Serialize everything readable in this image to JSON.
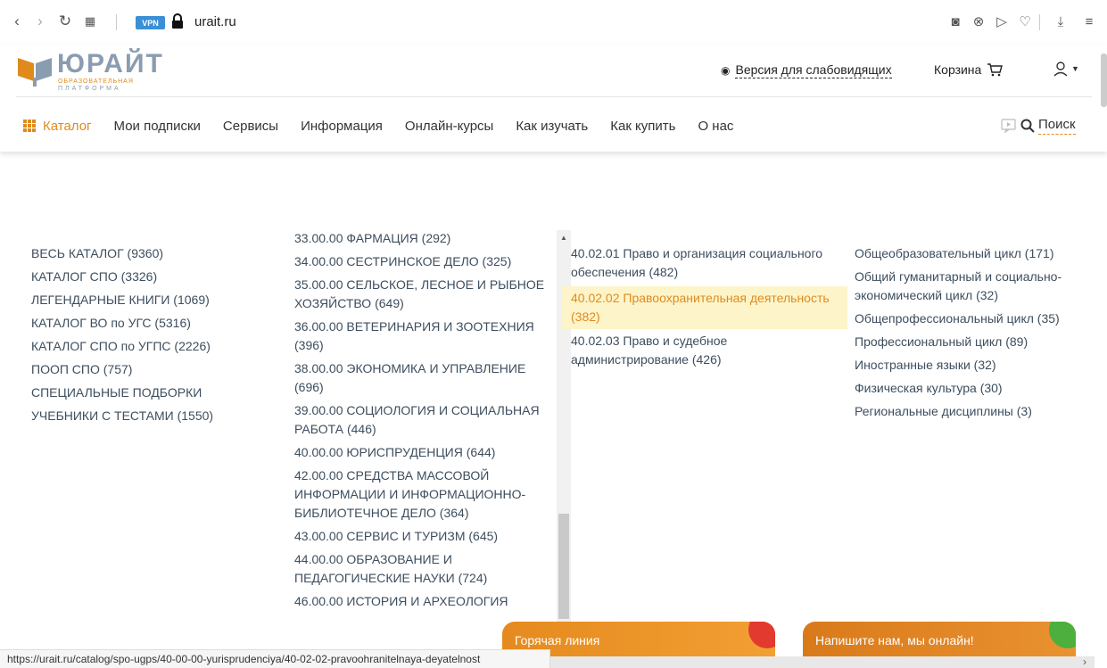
{
  "browser": {
    "url": "urait.ru",
    "vpn_label": "VPN"
  },
  "header": {
    "logo_main": "ЮРАЙТ",
    "logo_sub1": "ОБРАЗОВАТЕЛЬНАЯ",
    "logo_sub2": "ПЛАТФОРМА",
    "vision_label": "Версия для слабовидящих",
    "cart_label": "Корзина"
  },
  "nav": {
    "catalog": "Каталог",
    "items": [
      "Мои подписки",
      "Сервисы",
      "Информация",
      "Онлайн-курсы",
      "Как изучать",
      "Как купить",
      "О нас"
    ],
    "search_label": "Поиск"
  },
  "catalog": {
    "col1": [
      "ВЕСЬ КАТАЛОГ (9360)",
      "КАТАЛОГ СПО (3326)",
      "ЛЕГЕНДАРНЫЕ КНИГИ (1069)",
      "КАТАЛОГ ВО по УГС (5316)",
      "КАТАЛОГ СПО по УГПС (2226)",
      "ПООП СПО (757)",
      "СПЕЦИАЛЬНЫЕ ПОДБОРКИ",
      "УЧЕБНИКИ С ТЕСТАМИ (1550)"
    ],
    "col2": [
      "33.00.00 ФАРМАЦИЯ (292)",
      "34.00.00 СЕСТРИНСКОЕ ДЕЛО (325)",
      "35.00.00 СЕЛЬСКОЕ, ЛЕСНОЕ И РЫБНОЕ ХОЗЯЙСТВО (649)",
      "36.00.00 ВЕТЕРИНАРИЯ И ЗООТЕХНИЯ (396)",
      "38.00.00 ЭКОНОМИКА И УПРАВЛЕНИЕ (696)",
      "39.00.00 СОЦИОЛОГИЯ И СОЦИАЛЬНАЯ РАБОТА (446)",
      "40.00.00 ЮРИСПРУДЕНЦИЯ (644)",
      "42.00.00 СРЕДСТВА МАССОВОЙ ИНФОРМАЦИИ И ИНФОРМАЦИОННО-БИБЛИОТЕЧНОЕ ДЕЛО (364)",
      "43.00.00 СЕРВИС И ТУРИЗМ (645)",
      "44.00.00 ОБРАЗОВАНИЕ И ПЕДАГОГИЧЕСКИЕ НАУКИ (724)",
      "46.00.00 ИСТОРИЯ И АРХЕОЛОГИЯ"
    ],
    "col3": [
      "40.02.01 Право и организация социального обеспечения (482)",
      "40.02.02 Правоохранительная деятельность (382)",
      "40.02.03 Право и судебное администрирование (426)"
    ],
    "col3_active_index": 1,
    "col4": [
      "Общеобразовательный цикл (171)",
      "Общий гуманитарный и социально-экономический цикл (32)",
      "Общепрофессиональный цикл (35)",
      "Профессиональный цикл (89)",
      "Иностранные языки (32)",
      "Физическая культура (30)",
      "Региональные дисциплины (3)"
    ]
  },
  "chat": {
    "hotline": "Горячая линия",
    "online": "Напишите нам, мы онлайн!"
  },
  "status_url": "https://urait.ru/catalog/spo-ugps/40-00-00-yurisprudenciya/40-02-02-pravoohranitelnaya-deyatelnost",
  "colors": {
    "accent": "#e08a1e",
    "active_bg": "#fdf5c9",
    "text": "#3d4e5e"
  }
}
